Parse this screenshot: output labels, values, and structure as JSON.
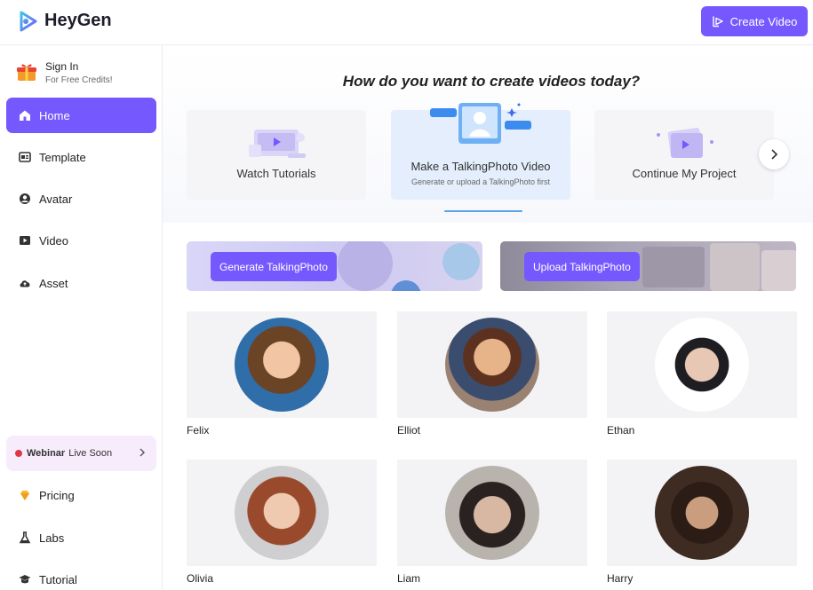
{
  "app": {
    "name": "HeyGen"
  },
  "header": {
    "create_video_label": "Create Video",
    "accent": "#7559ff"
  },
  "sidebar": {
    "signin": {
      "title": "Sign In",
      "subtitle": "For Free Credits!"
    },
    "items": [
      {
        "label": "Home",
        "icon": "home-icon",
        "active": true
      },
      {
        "label": "Template",
        "icon": "template-icon"
      },
      {
        "label": "Avatar",
        "icon": "avatar-icon"
      },
      {
        "label": "Video",
        "icon": "video-icon"
      },
      {
        "label": "Asset",
        "icon": "cloud-icon"
      }
    ],
    "webinar": {
      "bold": "Webinar",
      "text": "Live Soon"
    },
    "bottom_items": [
      {
        "label": "Pricing",
        "icon": "diamond-icon"
      },
      {
        "label": "Labs",
        "icon": "flask-icon"
      },
      {
        "label": "Tutorial",
        "icon": "graduation-cap-icon"
      }
    ]
  },
  "main": {
    "headline": "How do you want to create videos today?",
    "cards": [
      {
        "label": "Watch Tutorials"
      },
      {
        "label": "Make a TalkingPhoto Video",
        "sub": "Generate or upload a TalkingPhoto first"
      },
      {
        "label": "Continue My Project"
      }
    ],
    "banners": [
      {
        "label": "Generate TalkingPhoto"
      },
      {
        "label": "Upload TalkingPhoto"
      }
    ],
    "avatars": [
      {
        "name": "Felix"
      },
      {
        "name": "Elliot"
      },
      {
        "name": "Ethan"
      },
      {
        "name": "Olivia"
      },
      {
        "name": "Liam"
      },
      {
        "name": "Harry"
      }
    ]
  }
}
